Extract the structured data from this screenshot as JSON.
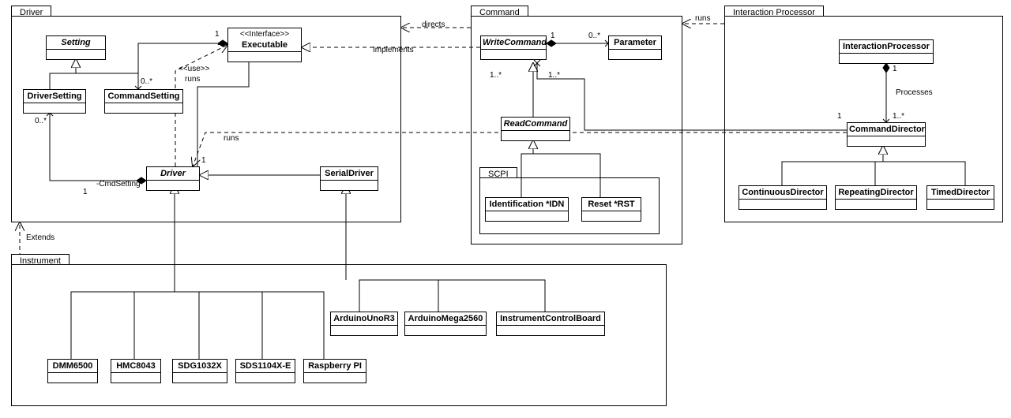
{
  "diagram_type": "UML class diagram",
  "packages": {
    "driver": {
      "label": "Driver"
    },
    "command": {
      "label": "Command"
    },
    "interaction": {
      "label": "Interaction Processor"
    },
    "scpi": {
      "label": "SCPI"
    },
    "instrument": {
      "label": "Instrument"
    }
  },
  "classes": {
    "setting": {
      "name": "Setting",
      "abstract": true
    },
    "driverSetting": {
      "name": "DriverSetting"
    },
    "commandSetting": {
      "name": "CommandSetting"
    },
    "executable": {
      "name": "Executable",
      "stereotype": "<<Interface>>"
    },
    "driverCls": {
      "name": "Driver",
      "abstract": true
    },
    "serialDriver": {
      "name": "SerialDriver"
    },
    "writeCommand": {
      "name": "WriteCommand",
      "abstract": true
    },
    "readCommand": {
      "name": "ReadCommand",
      "abstract": true
    },
    "parameter": {
      "name": "Parameter"
    },
    "identification": {
      "name": "Identification *IDN"
    },
    "reset": {
      "name": "Reset *RST"
    },
    "interactionProcessor": {
      "name": "InteractionProcessor"
    },
    "commandDirector": {
      "name": "CommandDirector"
    },
    "continuousDirector": {
      "name": "ContinuousDirector"
    },
    "repeatingDirector": {
      "name": "RepeatingDirector"
    },
    "timedDirector": {
      "name": "TimedDirector"
    },
    "arduinoUnoR3": {
      "name": "ArduinoUnoR3"
    },
    "arduinoMega2560": {
      "name": "ArduinoMega2560"
    },
    "instrumentControlBoard": {
      "name": "InstrumentControlBoard"
    },
    "dmm6500": {
      "name": "DMM6500"
    },
    "hmc8043": {
      "name": "HMC8043"
    },
    "sdg1032x": {
      "name": "SDG1032X"
    },
    "sds1104x": {
      "name": "SDS1104X-E"
    },
    "raspberrypi": {
      "name": "Raspberry PI"
    }
  },
  "labels": {
    "directs": "directs",
    "implements": "Implements",
    "use": "<<use>>",
    "runs": "runs",
    "runs2": "runs",
    "runs3": "runs",
    "extends": "Extends",
    "cmdSetting": "-CmdSetting",
    "processes": "Processes",
    "m1": "1",
    "m0s": "0..*",
    "m1s": "1..*"
  },
  "relationships": [
    {
      "from": "DriverSetting",
      "to": "Setting",
      "type": "generalization"
    },
    {
      "from": "CommandSetting",
      "to": "Setting",
      "type": "generalization"
    },
    {
      "from": "SerialDriver",
      "to": "Driver",
      "type": "generalization"
    },
    {
      "from": "ReadCommand",
      "to": "WriteCommand",
      "type": "generalization"
    },
    {
      "from": "Identification *IDN",
      "to": "ReadCommand",
      "type": "generalization"
    },
    {
      "from": "Reset *RST",
      "to": "ReadCommand",
      "type": "generalization"
    },
    {
      "from": "ContinuousDirector",
      "to": "CommandDirector",
      "type": "generalization"
    },
    {
      "from": "RepeatingDirector",
      "to": "CommandDirector",
      "type": "generalization"
    },
    {
      "from": "TimedDirector",
      "to": "CommandDirector",
      "type": "generalization"
    },
    {
      "from": "WriteCommand",
      "to": "Executable",
      "type": "realization",
      "label": "Implements"
    },
    {
      "from": "Executable",
      "to": "CommandSetting",
      "type": "composition",
      "end1": "1",
      "end2": "0..*"
    },
    {
      "from": "Driver",
      "to": "DriverSetting",
      "type": "composition",
      "label": "-CmdSetting",
      "end1": "1",
      "end2": "0..*"
    },
    {
      "from": "WriteCommand",
      "to": "Parameter",
      "type": "composition",
      "end1": "1",
      "end2": "0..*"
    },
    {
      "from": "InteractionProcessor",
      "to": "CommandDirector",
      "type": "composition",
      "label": "Processes",
      "end1": "1",
      "end2": "1..*"
    },
    {
      "from": "Driver",
      "to": "Executable",
      "type": "association",
      "end": "1"
    },
    {
      "from": "CommandDirector",
      "to": "WriteCommand",
      "type": "association",
      "end1": "1",
      "end2": "1..*"
    },
    {
      "from": "Driver pkg",
      "to": "Command pkg",
      "type": "dependency",
      "label": "directs"
    },
    {
      "from": "Command pkg",
      "to": "InteractionProcessor pkg",
      "type": "dependency",
      "label": "runs"
    },
    {
      "from": "Driver",
      "to": "Executable (use)",
      "type": "dependency",
      "label": "<<use>> runs"
    },
    {
      "from": "Instrument pkg",
      "to": "Driver pkg",
      "type": "dependency",
      "label": "Extends"
    },
    {
      "from": "CommandDirector",
      "to": "Driver",
      "type": "dependency",
      "label": "runs"
    }
  ]
}
